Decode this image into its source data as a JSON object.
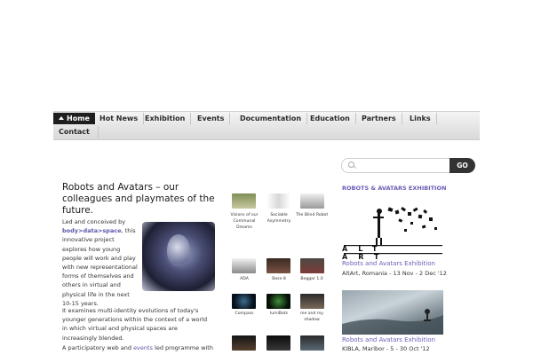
{
  "nav": {
    "items": [
      {
        "label": "Home",
        "active": true
      },
      {
        "label": "Hot News"
      },
      {
        "label": "Exhibition"
      },
      {
        "label": "Events"
      },
      {
        "label": "Documentation"
      },
      {
        "label": "Education"
      },
      {
        "label": "Partners"
      },
      {
        "label": "Links"
      },
      {
        "label": "Contact"
      }
    ]
  },
  "article": {
    "title": "Robots and Avatars – our colleagues and playmates of the future.",
    "p1_before": "Led and conceived by ",
    "p1_link": "body>data>space",
    "p1_after": ", this innovative project explores how young people will work and play with new representational forms of themselves and others in virtual and physical life in the next 10-15 years.",
    "p2": "It examines multi-identity evolutions of today's younger generations within the context of a world in which virtual and physical spaces are increasingly blended.",
    "p3_before": "A participatory web and ",
    "p3_link": "events",
    "p3_after": " led programme with"
  },
  "thumbs": [
    {
      "caption": "Visions of our Communal Dreams"
    },
    {
      "caption": "Sociable Asymmetry"
    },
    {
      "caption": "The Blind Robot"
    },
    {
      "caption": "ADA"
    },
    {
      "caption": "Base 8"
    },
    {
      "caption": "Beggar 1.0"
    },
    {
      "caption": "Compass"
    },
    {
      "caption": "lumiBots"
    },
    {
      "caption": "me and my shadow"
    }
  ],
  "sidebar": {
    "search_placeholder": "",
    "go_label": "GO",
    "heading": "ROBOTS & AVATARS EXHIBITION",
    "exhibit1_title": "Robots and Avatars Exhibition",
    "exhibit1_sub": "AltArt, Romania - 13 Nov - 2 Dec '12",
    "exhibit2_title": "Robots and Avatars Exhibition",
    "exhibit2_sub": "KIBLA, Maribor - 5 - 30 Oct '12",
    "logo_text": "ALT ART"
  },
  "colors": {
    "accent": "#6a5fb5",
    "link": "#5a55a8",
    "nav_active": "#1e1e1e"
  }
}
